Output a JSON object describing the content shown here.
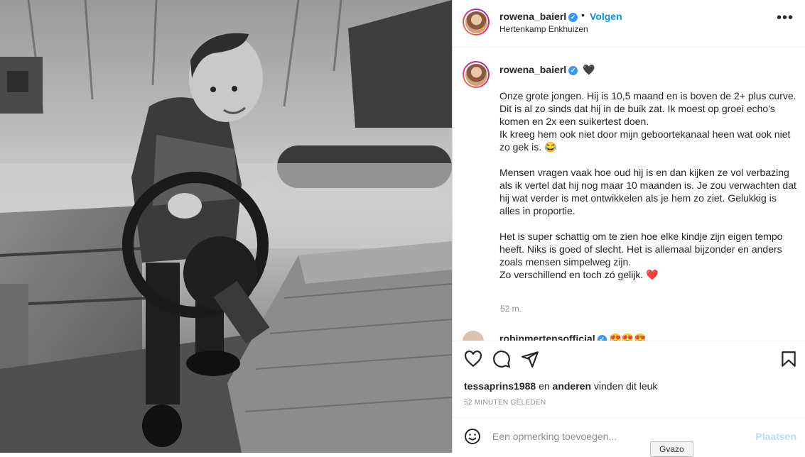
{
  "post": {
    "username": "rowena_baierl",
    "follow_label": "Volgen",
    "location": "Hertenkamp Enkhuizen",
    "caption_emoji": "🖤",
    "caption_paragraphs": [
      "Onze grote jongen. Hij is 10,5 maand en is boven de 2+ plus curve.\nDit is al zo sinds dat hij in de buik zat. Ik moest op groei echo's komen en 2x een suikertest doen.\nIk kreeg hem ook niet door mijn geboortekanaal heen wat ook niet zo gek is. 😂",
      "Mensen vragen vaak hoe oud hij is en dan kijken ze vol verbazing als ik vertel dat hij nog maar 10 maanden is. Je zou verwachten dat hij wat verder is met ontwikkelen als je hem zo ziet. Gelukkig is alles in proportie.",
      "Het is super schattig om te zien hoe elke kindje zijn eigen tempo heeft. Niks is goed of slecht. Het is allemaal bijzonder en anders zoals mensen simpelweg zijn.\nZo verschillend en toch zó gelijk. ❤️"
    ],
    "caption_time": "52 m.",
    "peek_comment_user": "robinmertensofficial",
    "peek_comment_text": "😍😍😍",
    "liked_by_user": "tessaprins1988",
    "liked_by_mid": "en",
    "liked_by_others": "anderen",
    "liked_by_suffix": "vinden dit leuk",
    "posted_ago": "52 MINUTEN GELEDEN",
    "comment_placeholder": "Een opmerking toevoegen...",
    "post_button": "Plaatsen"
  },
  "tooltip": "Gvazo",
  "icons": {
    "more": "more-options-icon",
    "like": "heart-icon",
    "comment": "comment-icon",
    "share": "share-icon",
    "save": "bookmark-icon",
    "emoji": "emoji-icon",
    "verified": "verified-badge-icon"
  },
  "colors": {
    "link_blue": "#0095f6",
    "post_disabled": "#b2dffc",
    "muted": "#8e8e8e"
  }
}
